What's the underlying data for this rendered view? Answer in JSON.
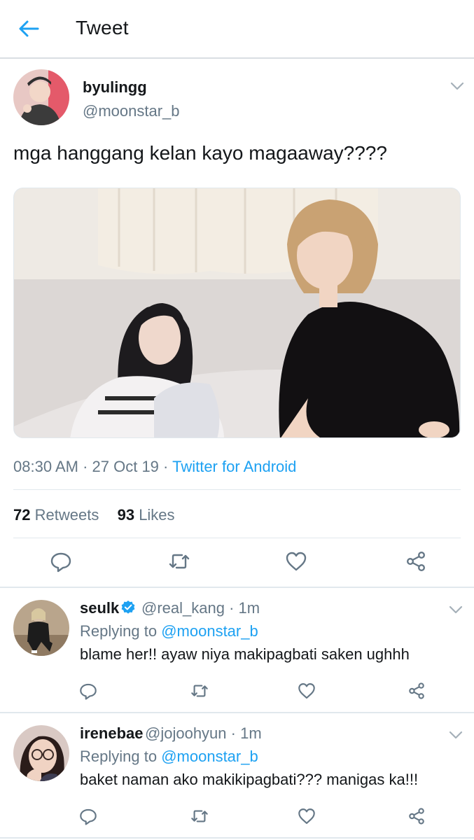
{
  "header": {
    "title": "Tweet",
    "back_icon": "arrow-left-icon",
    "accent": "#1da1f2"
  },
  "tweet": {
    "author_name": "byulingg",
    "author_handle": "@moonstar_b",
    "text": "mga hanggang kelan kayo magaaway????",
    "time": "08:30 AM",
    "date": "27 Oct 19",
    "source": "Twitter for Android",
    "retweets": "72",
    "retweets_label": "Retweets",
    "likes": "93",
    "likes_label": "Likes"
  },
  "actions": {
    "reply_icon": "reply-icon",
    "retweet_icon": "retweet-icon",
    "like_icon": "heart-icon",
    "share_icon": "share-icon"
  },
  "replies": [
    {
      "name": "seulk",
      "verified": true,
      "handle": "@real_kang",
      "time": "1m",
      "replying_label": "Replying to",
      "replying_to": "@moonstar_b",
      "text": "blame her!! ayaw niya makipagbati saken ughhh"
    },
    {
      "name": "irenebae",
      "verified": false,
      "handle": "@jojoohyun",
      "time": "1m",
      "replying_label": "Replying to",
      "replying_to": "@moonstar_b",
      "text": "baket naman ako makikipagbati??? manigas ka!!!"
    }
  ],
  "colors": {
    "text": "#14171a",
    "secondary": "#657786",
    "link": "#1da1f2",
    "divider": "#e1e8ed",
    "verified": "#1da1f2"
  }
}
